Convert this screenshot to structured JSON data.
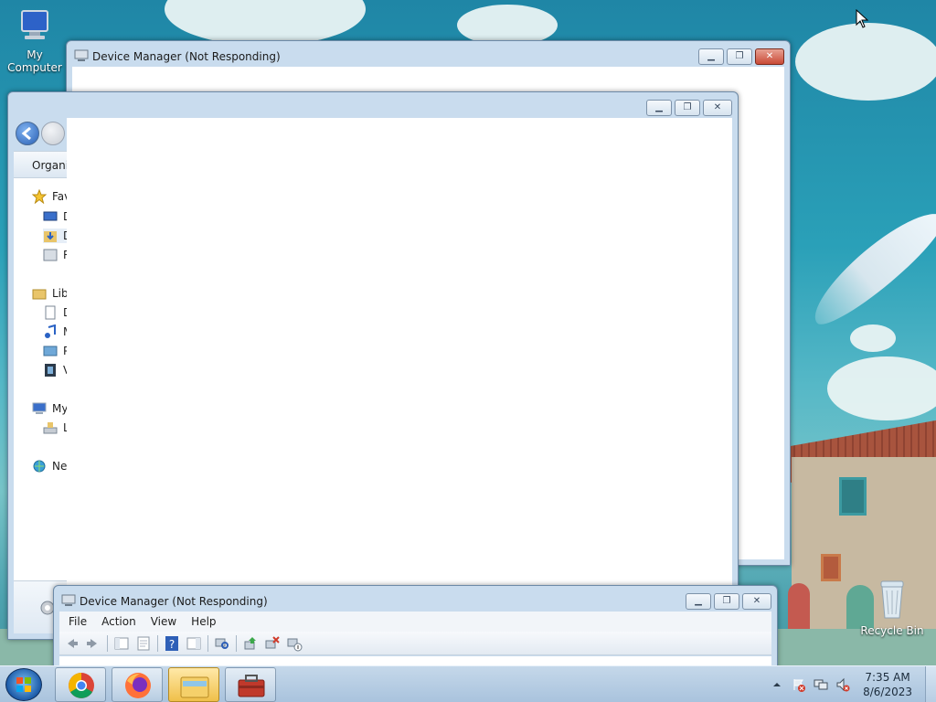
{
  "desktop": {
    "icons": [
      {
        "label": "My Computer",
        "icon": "computer-icon"
      },
      {
        "label": "Recycle Bin",
        "icon": "recycle-bin-icon"
      }
    ]
  },
  "windows": {
    "device_manager_back": {
      "title": "Device Manager (Not Responding)",
      "buttons": [
        "minimize",
        "maximize",
        "close"
      ]
    },
    "explorer": {
      "title": "",
      "toolbar_label": "Organiz",
      "tree": [
        {
          "label": "Fav",
          "icon": "star-icon"
        },
        {
          "label": "D",
          "icon": "desktop-icon"
        },
        {
          "label": "D",
          "icon": "downloads-icon"
        },
        {
          "label": "R",
          "icon": "recent-places-icon"
        },
        {
          "label": "Lib",
          "icon": "libraries-icon"
        },
        {
          "label": "D",
          "icon": "documents-icon"
        },
        {
          "label": "M",
          "icon": "music-icon"
        },
        {
          "label": "P",
          "icon": "pictures-icon"
        },
        {
          "label": "V",
          "icon": "videos-icon"
        },
        {
          "label": "My",
          "icon": "computer-icon"
        },
        {
          "label": "L",
          "icon": "local-disk-icon"
        },
        {
          "label": "Ne",
          "icon": "network-icon"
        }
      ]
    },
    "device_manager_front": {
      "title": "Device Manager (Not Responding)",
      "menu": [
        "File",
        "Action",
        "View",
        "Help"
      ]
    }
  },
  "taskbar": {
    "apps": [
      {
        "name": "chrome",
        "icon": "chrome-icon"
      },
      {
        "name": "firefox",
        "icon": "firefox-icon"
      },
      {
        "name": "explorer",
        "icon": "folder-icon",
        "active": true
      },
      {
        "name": "toolbox",
        "icon": "toolbox-icon"
      }
    ],
    "time": "7:35 AM",
    "date": "8/6/2023"
  },
  "glyphs": {
    "minimize": "▁",
    "maximize": "❐",
    "close": "✕"
  }
}
